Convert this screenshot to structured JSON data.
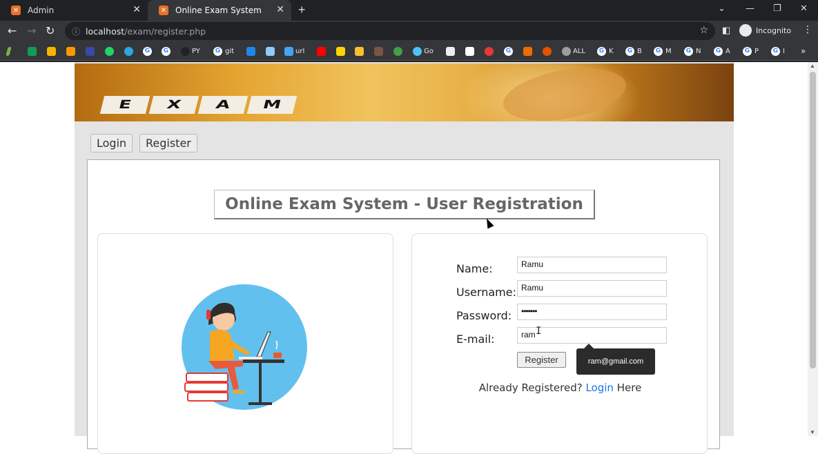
{
  "browser": {
    "tabs": [
      {
        "title": "Admin",
        "favicon": "xampp-icon"
      },
      {
        "title": "Online Exam System",
        "favicon": "xampp-icon"
      }
    ],
    "address": {
      "host": "localhost",
      "path": "/exam/register.php"
    },
    "profile_label": "Incognito",
    "bookmarks": [
      "PY",
      "git",
      "url",
      "Go",
      "ALL",
      "K",
      "B",
      "M",
      "N",
      "A",
      "P",
      "I"
    ]
  },
  "page": {
    "banner_letters": [
      "E",
      "X",
      "A",
      "M"
    ],
    "nav": {
      "login_label": "Login",
      "register_label": "Register"
    },
    "title": "Online Exam System - User Registration",
    "form": {
      "name_label": "Name:",
      "name_value": "Ramu",
      "username_label": "Username:",
      "username_value": "Ramu",
      "password_label": "Password:",
      "password_value": "•••••••",
      "email_label": "E-mail:",
      "email_value": "ram",
      "submit_label": "Register",
      "autocomplete_suggestion": "ram@gmail.com"
    },
    "already_registered": {
      "prefix": "Already Registered?",
      "link": "Login",
      "suffix": "Here"
    }
  },
  "colors": {
    "chrome_dark": "#202124",
    "toolbar": "#35363a",
    "link": "#1a73e8",
    "xampp": "#e8712b"
  }
}
